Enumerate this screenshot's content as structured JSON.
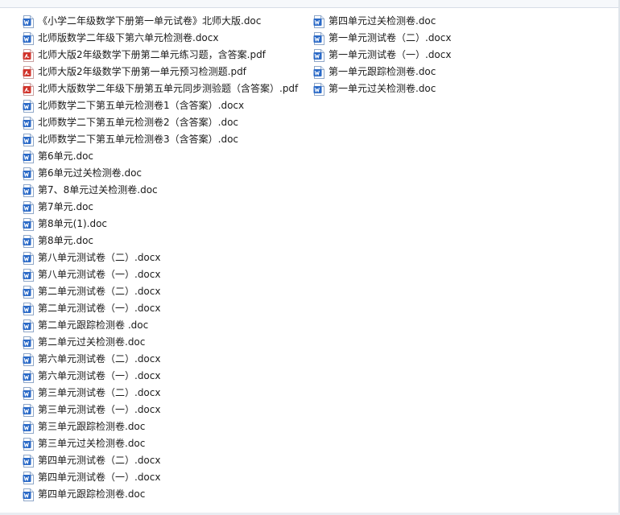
{
  "colors": {
    "word_blue": "#2b6ac7",
    "pdf_red": "#d0342c",
    "text": "#1a1a1a"
  },
  "columns": [
    {
      "items": [
        {
          "name": "《小学二年级数学下册第一单元试卷》北师大版.doc",
          "icon": "word-doc-icon",
          "type": "word"
        },
        {
          "name": "北师版数学二年级下第六单元检测卷.docx",
          "icon": "word-doc-icon",
          "type": "word"
        },
        {
          "name": "北师大版2年级数学下册第二单元练习题，含答案.pdf",
          "icon": "pdf-icon",
          "type": "pdf"
        },
        {
          "name": "北师大版2年级数学下册第一单元预习检测题.pdf",
          "icon": "pdf-icon",
          "type": "pdf"
        },
        {
          "name": "北师大版数学二年级下册第五单元同步测验题（含答案）.pdf",
          "icon": "pdf-icon",
          "type": "pdf"
        },
        {
          "name": "北师数学二下第五单元检测卷1（含答案）.docx",
          "icon": "word-doc-icon",
          "type": "word"
        },
        {
          "name": "北师数学二下第五单元检测卷2（含答案）.doc",
          "icon": "word-doc-icon",
          "type": "word"
        },
        {
          "name": "北师数学二下第五单元检测卷3（含答案）.doc",
          "icon": "word-doc-icon",
          "type": "word"
        },
        {
          "name": "第6单元.doc",
          "icon": "word-doc-icon",
          "type": "word"
        },
        {
          "name": "第6单元过关检测卷.doc",
          "icon": "word-doc-icon",
          "type": "word"
        },
        {
          "name": "第7、8单元过关检测卷.doc",
          "icon": "word-doc-icon",
          "type": "word"
        },
        {
          "name": "第7单元.doc",
          "icon": "word-doc-icon",
          "type": "word"
        },
        {
          "name": "第8单元(1).doc",
          "icon": "word-doc-icon",
          "type": "word"
        },
        {
          "name": "第8单元.doc",
          "icon": "word-doc-icon",
          "type": "word"
        },
        {
          "name": "第八单元测试卷（二）.docx",
          "icon": "word-doc-icon",
          "type": "word"
        },
        {
          "name": "第八单元测试卷（一）.docx",
          "icon": "word-doc-icon",
          "type": "word"
        },
        {
          "name": "第二单元测试卷（二）.docx",
          "icon": "word-doc-icon",
          "type": "word"
        },
        {
          "name": "第二单元测试卷（一）.docx",
          "icon": "word-doc-icon",
          "type": "word"
        },
        {
          "name": "第二单元跟踪检测卷 .doc",
          "icon": "word-doc-icon",
          "type": "word"
        },
        {
          "name": "第二单元过关检测卷.doc",
          "icon": "word-doc-icon",
          "type": "word"
        },
        {
          "name": "第六单元测试卷（二）.docx",
          "icon": "word-doc-icon",
          "type": "word"
        },
        {
          "name": "第六单元测试卷（一）.docx",
          "icon": "word-doc-icon",
          "type": "word"
        },
        {
          "name": "第三单元测试卷（二）.docx",
          "icon": "word-doc-icon",
          "type": "word"
        },
        {
          "name": "第三单元测试卷（一）.docx",
          "icon": "word-doc-icon",
          "type": "word"
        },
        {
          "name": "第三单元跟踪检测卷.doc",
          "icon": "word-doc-icon",
          "type": "word"
        },
        {
          "name": "第三单元过关检测卷.doc",
          "icon": "word-doc-icon",
          "type": "word"
        },
        {
          "name": "第四单元测试卷（二）.docx",
          "icon": "word-doc-icon",
          "type": "word"
        },
        {
          "name": "第四单元测试卷（一）.docx",
          "icon": "word-doc-icon",
          "type": "word"
        },
        {
          "name": "第四单元跟踪检测卷.doc",
          "icon": "word-doc-icon",
          "type": "word"
        }
      ]
    },
    {
      "items": [
        {
          "name": "第四单元过关检测卷.doc",
          "icon": "word-doc-icon",
          "type": "word"
        },
        {
          "name": "第一单元测试卷（二）.docx",
          "icon": "word-doc-icon",
          "type": "word"
        },
        {
          "name": "第一单元测试卷（一）.docx",
          "icon": "word-doc-icon",
          "type": "word"
        },
        {
          "name": "第一单元跟踪检测卷.doc",
          "icon": "word-doc-icon",
          "type": "word"
        },
        {
          "name": "第一单元过关检测卷.doc",
          "icon": "word-doc-icon",
          "type": "word"
        }
      ]
    }
  ]
}
